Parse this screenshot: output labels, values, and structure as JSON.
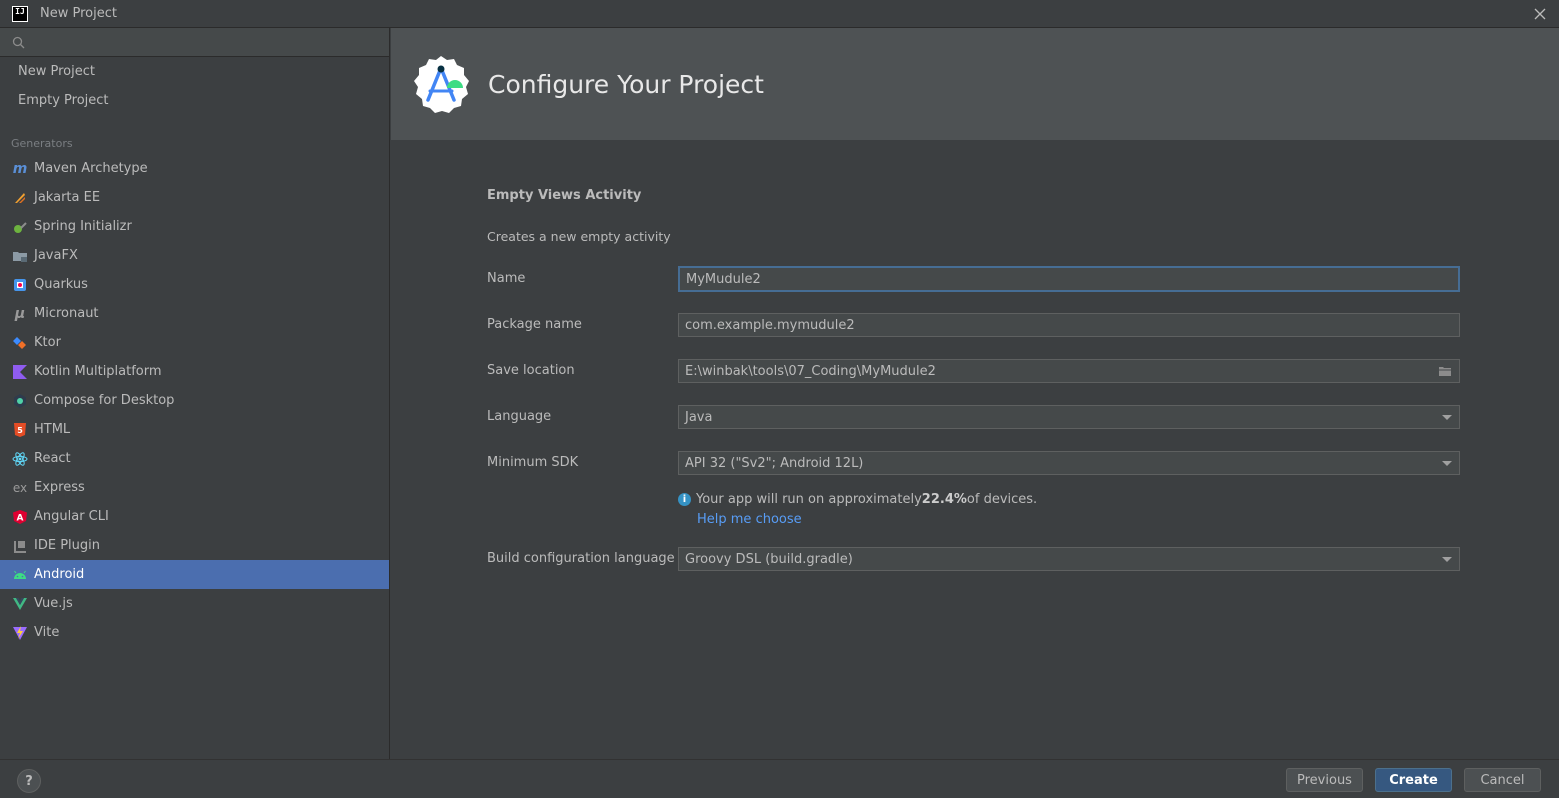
{
  "window": {
    "title": "New Project"
  },
  "search": {
    "placeholder": ""
  },
  "sidebar": {
    "top_items": [
      {
        "label": "New Project"
      },
      {
        "label": "Empty Project"
      }
    ],
    "group_label": "Generators",
    "generators": [
      {
        "label": "Maven Archetype",
        "icon": "maven-icon"
      },
      {
        "label": "Jakarta EE",
        "icon": "jakarta-icon"
      },
      {
        "label": "Spring Initializr",
        "icon": "spring-icon"
      },
      {
        "label": "JavaFX",
        "icon": "javafx-icon"
      },
      {
        "label": "Quarkus",
        "icon": "quarkus-icon"
      },
      {
        "label": "Micronaut",
        "icon": "micronaut-icon"
      },
      {
        "label": "Ktor",
        "icon": "ktor-icon"
      },
      {
        "label": "Kotlin Multiplatform",
        "icon": "kotlin-icon"
      },
      {
        "label": "Compose for Desktop",
        "icon": "compose-icon"
      },
      {
        "label": "HTML",
        "icon": "html5-icon"
      },
      {
        "label": "React",
        "icon": "react-icon"
      },
      {
        "label": "Express",
        "icon": "express-icon"
      },
      {
        "label": "Angular CLI",
        "icon": "angular-icon"
      },
      {
        "label": "IDE Plugin",
        "icon": "plugin-icon"
      },
      {
        "label": "Android",
        "icon": "android-icon",
        "selected": true
      },
      {
        "label": "Vue.js",
        "icon": "vue-icon"
      },
      {
        "label": "Vite",
        "icon": "vite-icon"
      }
    ]
  },
  "header": {
    "title": "Configure Your Project"
  },
  "form": {
    "activity_title": "Empty Views Activity",
    "activity_desc": "Creates a new empty activity",
    "name_label": "Name",
    "name_value": "MyMudule2",
    "package_label": "Package name",
    "package_value": "com.example.mymudule2",
    "save_label": "Save location",
    "save_value": "E:\\winbak\\tools\\07_Coding\\MyMudule2",
    "language_label": "Language",
    "language_value": "Java",
    "sdk_label": "Minimum SDK",
    "sdk_value": "API 32 (\"Sv2\"; Android 12L)",
    "info_prefix": "Your app will run on approximately ",
    "info_percent": "22.4%",
    "info_suffix": " of devices.",
    "help_link": "Help me choose",
    "build_label": "Build configuration language",
    "build_value": "Groovy DSL (build.gradle)"
  },
  "footer": {
    "help": "?",
    "previous": "Previous",
    "create": "Create",
    "cancel": "Cancel"
  },
  "colors": {
    "selection": "#4b6eaf",
    "link": "#589df6",
    "primary_button": "#365880",
    "focus_border": "#466d94"
  }
}
